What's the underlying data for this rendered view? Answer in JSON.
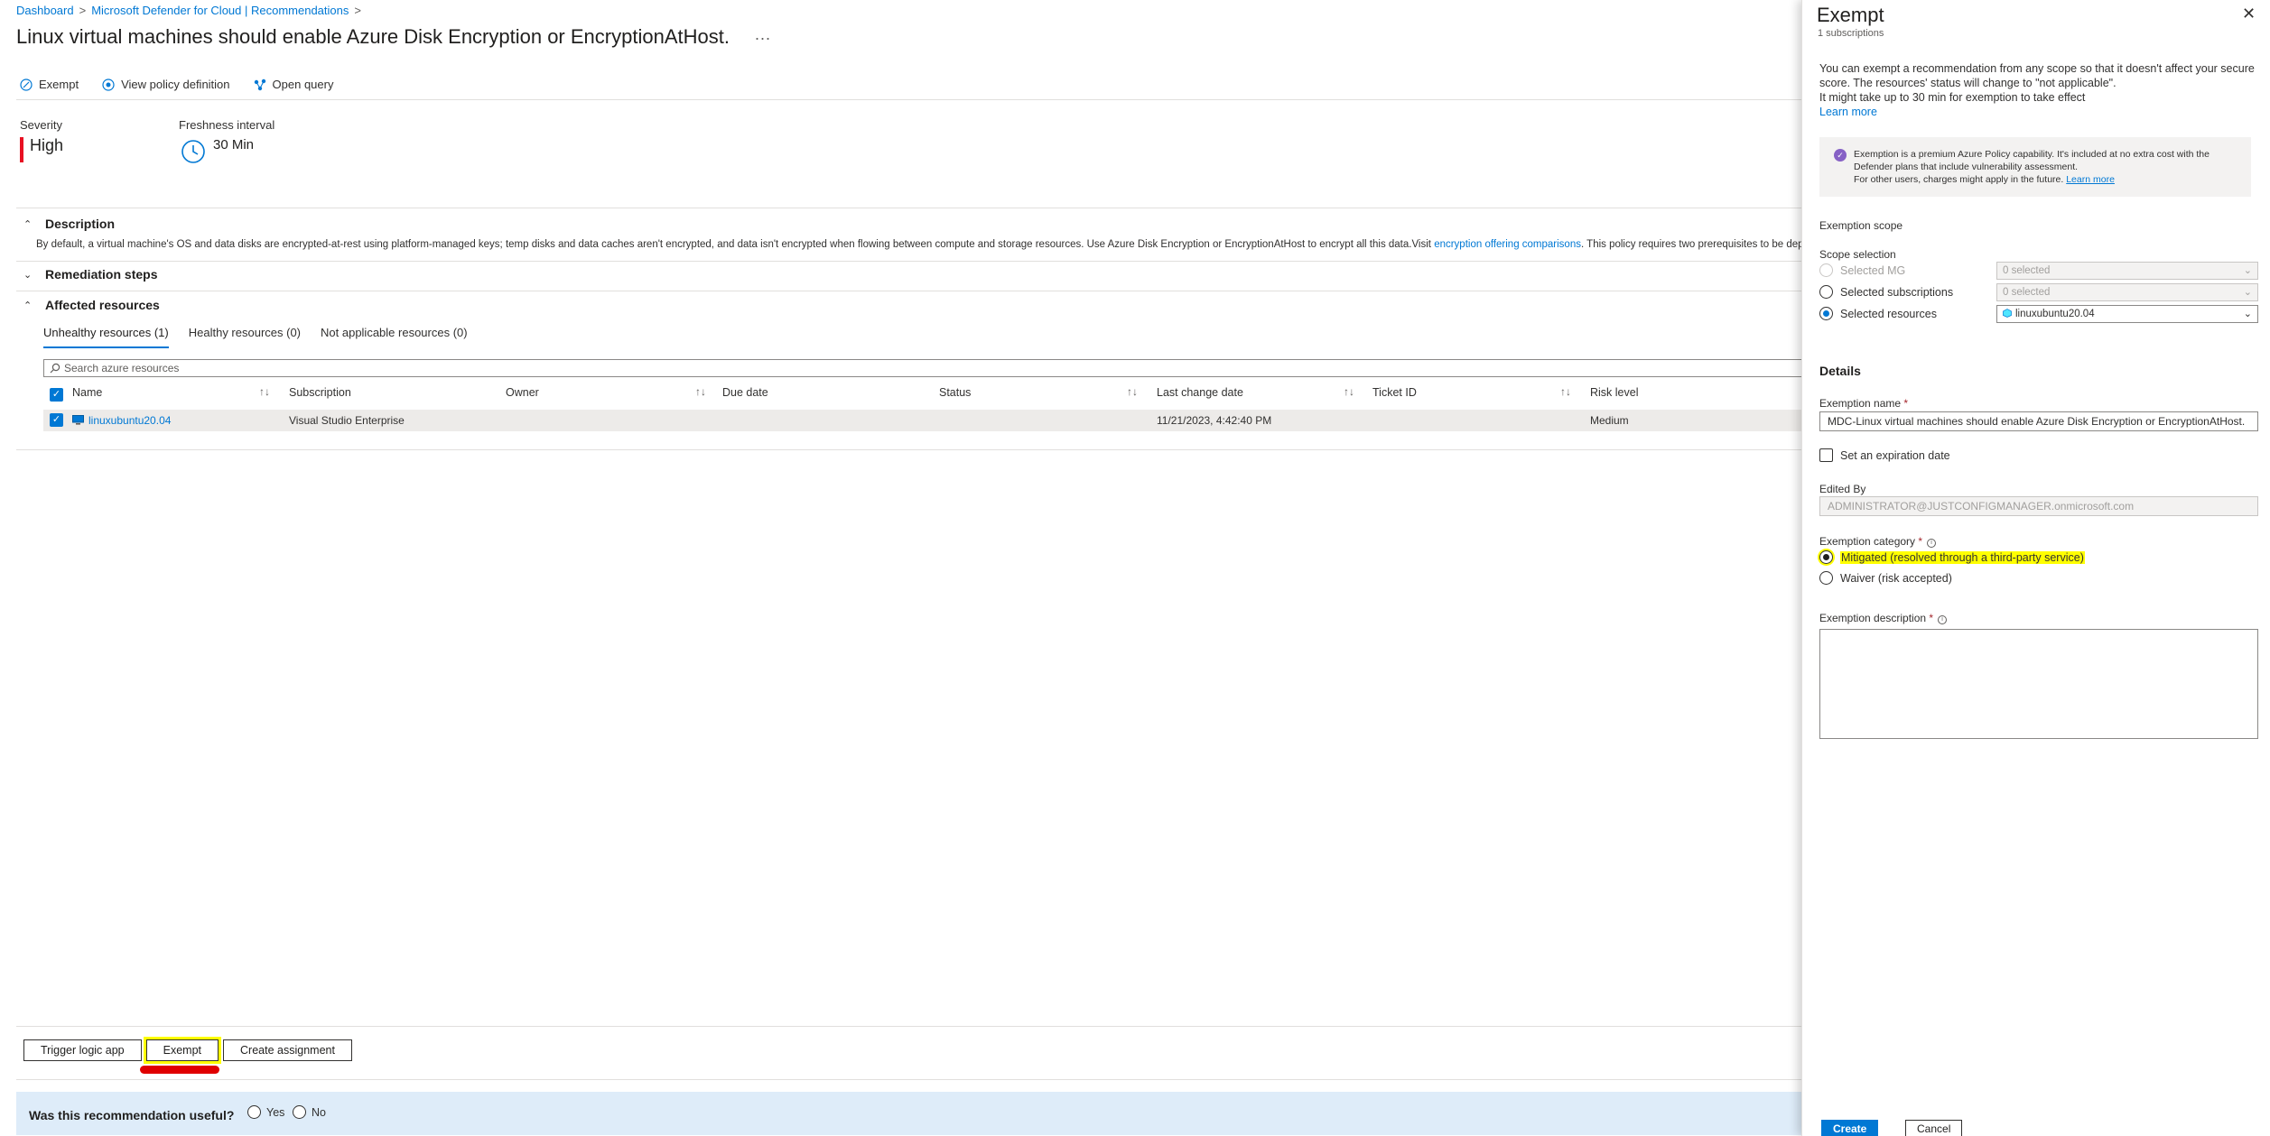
{
  "breadcrumb": [
    "Dashboard",
    "Microsoft Defender for Cloud | Recommendations"
  ],
  "page_title": "Linux virtual machines should enable Azure Disk Encryption or EncryptionAtHost.",
  "title_more": "...",
  "toolbar": {
    "exempt": "Exempt",
    "view_policy": "View policy definition",
    "open_query": "Open query"
  },
  "severity": {
    "label": "Severity",
    "value": "High",
    "color": "#e81123"
  },
  "freshness": {
    "label": "Freshness interval",
    "value": "30 Min"
  },
  "description": {
    "header": "Description",
    "text": "By default, a virtual machine's OS and data disks are encrypted-at-rest using platform-managed keys; temp disks and data caches aren't encrypted, and data isn't encrypted when flowing between compute and storage resources. Use Azure Disk Encryption or EncryptionAtHost to encrypt all this data.Visit ",
    "link": "encryption offering comparisons",
    "text_after": ". This policy requires two prerequisites to be deployed to the policy assignment scope."
  },
  "remediation_header": "Remediation steps",
  "affected_header": "Affected resources",
  "tabs": [
    "Unhealthy resources (1)",
    "Healthy resources (0)",
    "Not applicable resources (0)"
  ],
  "search_placeholder": "Search azure resources",
  "columns": {
    "name": "Name",
    "subscription": "Subscription",
    "owner": "Owner",
    "due_date": "Due date",
    "status": "Status",
    "last_change": "Last change date",
    "ticket": "Ticket ID",
    "risk": "Risk level"
  },
  "row": {
    "name": "linuxubuntu20.04",
    "subscription": "Visual Studio Enterprise",
    "owner": "",
    "due_date": "",
    "status": "",
    "last_change": "11/21/2023, 4:42:40 PM",
    "ticket": "",
    "risk": "Medium"
  },
  "actions": {
    "trigger": "Trigger logic app",
    "exempt": "Exempt",
    "create_assignment": "Create assignment"
  },
  "feedback": {
    "question": "Was this recommendation useful?",
    "yes": "Yes",
    "no": "No"
  },
  "panel": {
    "title": "Exempt",
    "subtitle": "1 subscriptions",
    "intro_1": "You can exempt a recommendation from any scope so that it doesn't affect your secure score. The resources' status will change to \"not applicable\".",
    "intro_2": "It might take up to 30 min for exemption to take effect",
    "learn_more": "Learn more",
    "info_1": "Exemption is a premium Azure Policy capability. It's included at no extra cost with the Defender plans that include vulnerability assessment.",
    "info_2": "For other users, charges might apply in the future.",
    "info_link": "Learn more",
    "scope_header": "Exemption scope",
    "scope_selection": "Scope selection",
    "scope_options": [
      "Selected MG",
      "Selected subscriptions",
      "Selected resources"
    ],
    "scope_values": [
      "0 selected",
      "0 selected",
      "linuxubuntu20.04"
    ],
    "details_header": "Details",
    "name_label": "Exemption name",
    "name_value": "MDC-Linux virtual machines should enable Azure Disk Encryption or EncryptionAtHost.",
    "expiration_label": "Set an expiration date",
    "edited_by_label": "Edited By",
    "edited_by_value": "ADMINISTRATOR@JUSTCONFIGMANAGER.onmicrosoft.com",
    "category_label": "Exemption category",
    "category_options": [
      "Mitigated (resolved through a third-party service)",
      "Waiver (risk accepted)"
    ],
    "description_label": "Exemption description",
    "create": "Create",
    "cancel": "Cancel"
  }
}
